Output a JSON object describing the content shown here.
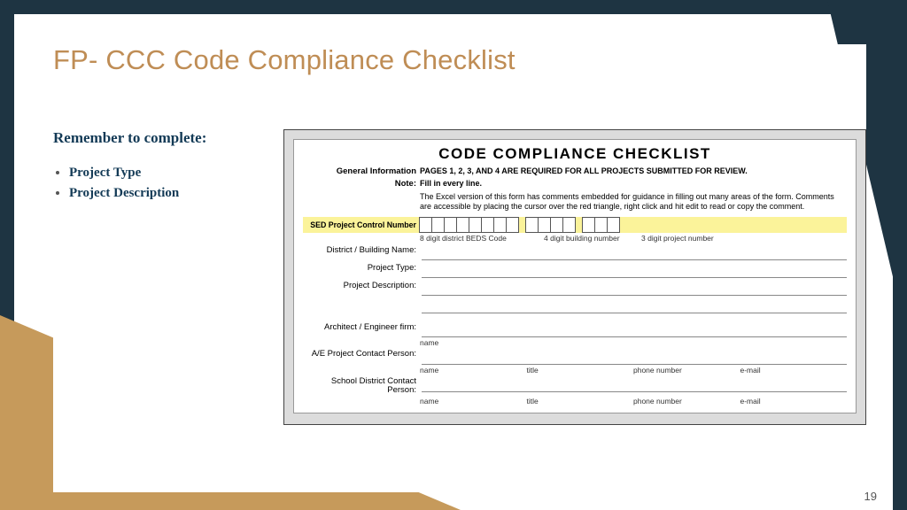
{
  "slide": {
    "title": "FP- CCC Code Compliance Checklist",
    "page_number": "19",
    "subhead": "Remember to complete:",
    "bullets": [
      "Project Type",
      "Project Description"
    ]
  },
  "form": {
    "title": "CODE  COMPLIANCE  CHECKLIST",
    "general_lab": "General Information",
    "general_text": "PAGES 1, 2, 3, AND 4 ARE REQUIRED FOR ALL PROJECTS SUBMITTED FOR REVIEW.",
    "note_lab": "Note:",
    "note_line1": "Fill in every line.",
    "note_line2": "The Excel version of this form has comments embedded for guidance in filling out many areas of the form.  Comments are accessible by placing the cursor over the red triangle, right click and hit edit to read or copy the comment.",
    "sed_lab": "SED Project Control Number",
    "code_sub1": "8 digit district BEDS Code",
    "code_sub2": "4 digit building number",
    "code_sub3": "3 digit project number",
    "district_lab": "District / Building Name:",
    "ptype_lab": "Project Type:",
    "pdesc_lab": "Project Description:",
    "ae_firm_lab": "Architect / Engineer firm:",
    "ae_contact_lab": "A/E Project Contact Person:",
    "sd_contact_lab": "School District Contact Person:",
    "col_name": "name",
    "col_title": "title",
    "col_phone": "phone number",
    "col_email": "e-mail"
  }
}
